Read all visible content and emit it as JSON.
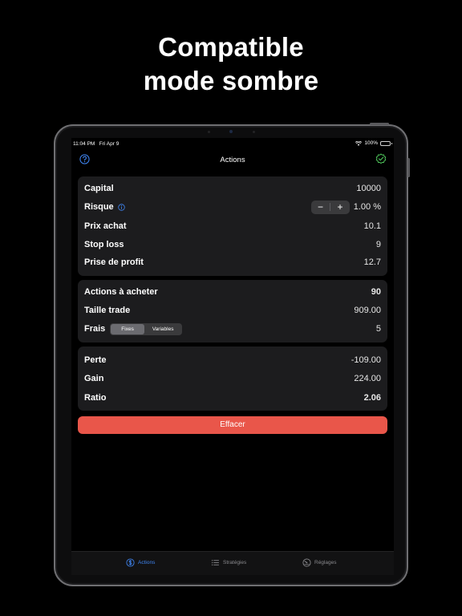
{
  "headline": {
    "line1": "Compatible",
    "line2": "mode sombre"
  },
  "status_bar": {
    "time": "11:04 PM",
    "date": "Fri Apr 9",
    "battery": "100%"
  },
  "nav": {
    "title": "Actions",
    "left_icon": "question-circle-icon",
    "right_icon": "check-badge-icon"
  },
  "inputs": {
    "capital": {
      "label": "Capital",
      "value": "10000"
    },
    "risque": {
      "label": "Risque",
      "value": "1.00 %",
      "minus": "−",
      "plus": "+"
    },
    "prix_achat": {
      "label": "Prix achat",
      "value": "10.1"
    },
    "stop_loss": {
      "label": "Stop loss",
      "value": "9"
    },
    "prise_profit": {
      "label": "Prise de profit",
      "value": "12.7"
    }
  },
  "results": {
    "actions": {
      "label": "Actions à acheter",
      "value": "90"
    },
    "taille": {
      "label": "Taille trade",
      "value": "909.00"
    },
    "frais": {
      "label": "Frais",
      "value": "5",
      "segments": [
        "Fixes",
        "Variables"
      ],
      "selected": "Fixes"
    }
  },
  "summary": {
    "perte": {
      "label": "Perte",
      "value": "-109.00"
    },
    "gain": {
      "label": "Gain",
      "value": "224.00"
    },
    "ratio": {
      "label": "Ratio",
      "value": "2.06"
    }
  },
  "clear_button": "Effacer",
  "tabs": [
    {
      "label": "Actions",
      "icon": "dollar-circle-icon",
      "active": true
    },
    {
      "label": "Stratégies",
      "icon": "list-icon",
      "active": false
    },
    {
      "label": "Réglages",
      "icon": "gauge-icon",
      "active": false
    }
  ],
  "colors": {
    "accent": "#3f84f0",
    "danger": "#e9564a",
    "loss": "#e94b3c",
    "profit": "#4ec45a",
    "card": "#1c1c1e"
  }
}
